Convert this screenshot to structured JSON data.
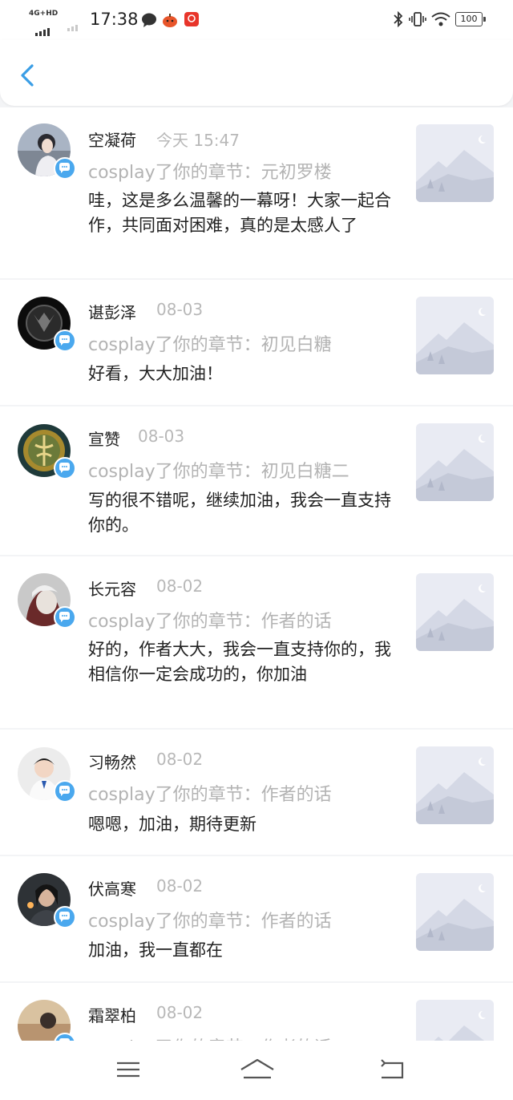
{
  "status_bar": {
    "network": "4G+HD",
    "time": "17:38",
    "battery": "100",
    "icons": [
      "signal-icon",
      "signal-weak-icon",
      "chat-bubble-icon",
      "pumpkin-app-icon",
      "shopping-app-icon",
      "bluetooth-icon",
      "vibrate-icon",
      "wifi-icon",
      "battery-icon"
    ]
  },
  "header": {
    "back_icon": "chevron-left-icon",
    "accent": "#3a9ee6"
  },
  "comments": [
    {
      "name": "空凝荷",
      "time": "今天 15:47",
      "subtitle": "cosplay了你的章节：元初罗楼",
      "content": "哇，这是多么温馨的一幕呀！大家一起合作，共同面对困难，真的是太感人了"
    },
    {
      "name": "谌彭泽",
      "time": "08-03",
      "subtitle": "cosplay了你的章节：初见白糖",
      "content": "好看，大大加油！"
    },
    {
      "name": "宣赞",
      "time": "08-03",
      "subtitle": "cosplay了你的章节：初见白糖二",
      "content": "写的很不错呢，继续加油，我会一直支持你的。"
    },
    {
      "name": "长元容",
      "time": "08-02",
      "subtitle": "cosplay了你的章节：作者的话",
      "content": "好的，作者大大，我会一直支持你的，我相信你一定会成功的，你加油"
    },
    {
      "name": "习畅然",
      "time": "08-02",
      "subtitle": "cosplay了你的章节：作者的话",
      "content": "嗯嗯，加油，期待更新"
    },
    {
      "name": "伏高寒",
      "time": "08-02",
      "subtitle": "cosplay了你的章节：作者的话",
      "content": "加油，我一直都在"
    },
    {
      "name": "霜翠柏",
      "time": "08-02",
      "subtitle": "cosplay了你的章节：作者的话",
      "content": ""
    }
  ],
  "badge_color": "#4aa8ee",
  "nav_bar": {
    "icons": [
      "menu-icon",
      "home-icon",
      "back-icon"
    ]
  }
}
